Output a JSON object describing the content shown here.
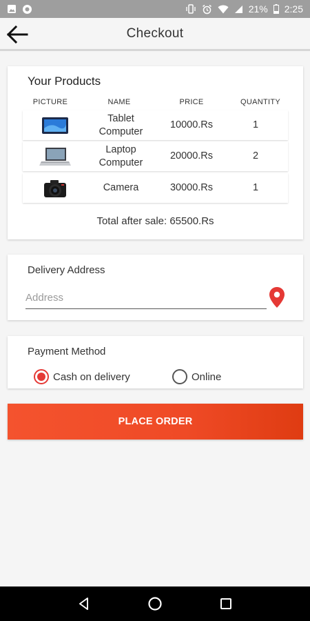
{
  "status_bar": {
    "battery": "21%",
    "time": "2:25",
    "left_icons": [
      "image-icon",
      "notification-circle-icon"
    ],
    "right_icons": [
      "vibrate-icon",
      "alarm-icon",
      "wifi-icon",
      "signal-icon",
      "battery-icon"
    ]
  },
  "toolbar": {
    "title": "Checkout",
    "back_icon": "arrow-left-icon"
  },
  "products": {
    "title": "Your Products",
    "headers": {
      "picture": "PICTURE",
      "name": "NAME",
      "price": "PRICE",
      "quantity": "QUANTITY"
    },
    "rows": [
      {
        "name_line1": "Tablet",
        "name_line2": "Computer",
        "price": "10000.Rs",
        "quantity": "1",
        "picture": "tablet-image"
      },
      {
        "name_line1": "Laptop",
        "name_line2": "Computer",
        "price": "20000.Rs",
        "quantity": "2",
        "picture": "laptop-image"
      },
      {
        "name_line1": "Camera",
        "name_line2": "",
        "price": "30000.Rs",
        "quantity": "1",
        "picture": "camera-image"
      }
    ],
    "total": "Total after sale:  65500.Rs"
  },
  "delivery": {
    "label": "Delivery Address",
    "placeholder": "Address",
    "value": "",
    "pin_icon": "location-pin-icon",
    "pin_color": "#e53935"
  },
  "payment": {
    "label": "Payment Method",
    "options": [
      {
        "label": "Cash on delivery",
        "selected": true
      },
      {
        "label": "Online",
        "selected": false
      }
    ],
    "accent_color": "#e53935"
  },
  "actions": {
    "place_order": "PLACE ORDER",
    "button_color": "#f04a24"
  },
  "nav_bar": {
    "buttons": [
      "back-triangle-icon",
      "home-circle-icon",
      "recents-square-icon"
    ]
  }
}
